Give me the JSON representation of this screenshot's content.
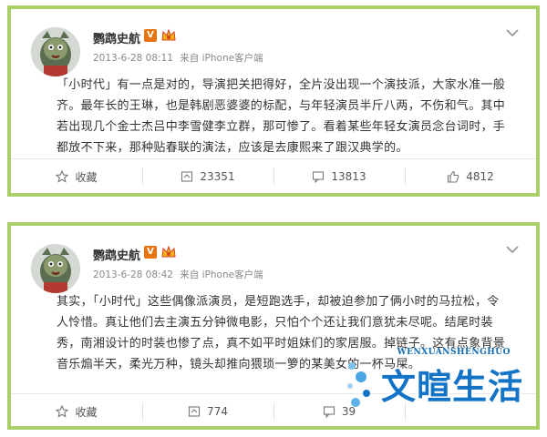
{
  "posts": [
    {
      "username": "鹦鹉史航",
      "verified_badge": "V",
      "timestamp": "2013-6-28 08:11",
      "source_prefix": "来自",
      "source": "iPhone客户端",
      "text": "「小时代」有一点是对的，导演把关把得好，全片没出现一个演技派，大家水准一般齐。最年长的王琳，也是韩剧恶婆婆的标配，与年轻演员半斤八两，不伤和气。其中若出现几个金士杰吕中李雪健李立群，那可惨了。看着某些年轻女演员念台词时，手都放不下来，那种贴春联的演法，应该是去康熙来了跟汉典学的。",
      "actions": {
        "favorite_label": "收藏",
        "repost_count": "23351",
        "comment_count": "13813",
        "like_count": "4812"
      }
    },
    {
      "username": "鹦鹉史航",
      "verified_badge": "V",
      "timestamp": "2013-6-28 08:42",
      "source_prefix": "来自",
      "source": "iPhone客户端",
      "text": "其实，「小时代」这些偶像派演员，是短跑选手，却被迫参加了俩小时的马拉松，令人怜惜。真让他们去主演五分钟微电影，只怕个个还让我们意犹未尽呢。结尾时装秀，南湘设计的时装也惨了点，真不如平时姐妹们的家居服。掉链子。这有点象背景音乐煽半天，柔光万种，镜头却推向猥琐一箩的某美女的一杯马屎。",
      "actions": {
        "favorite_label": "收藏",
        "repost_count": "774",
        "comment_count": "39",
        "like_count": ""
      }
    }
  ],
  "watermark": {
    "small_text": "WENXUANSHENGHUO",
    "big_text": "文暄生活"
  },
  "colors": {
    "card_border": "#a8cf6a",
    "badge": "#e8740f",
    "watermark": "#1273c7"
  },
  "icons": [
    "star-icon",
    "repost-icon",
    "comment-icon",
    "thumbs-up-icon",
    "chevron-down-icon",
    "crown-icon"
  ]
}
